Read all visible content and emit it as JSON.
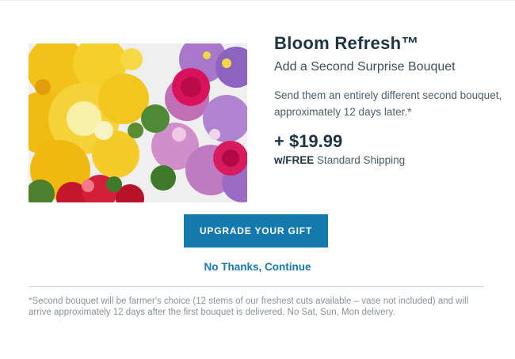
{
  "product": {
    "image_alt": "flower bouquet",
    "title": "Bloom Refresh™",
    "subtitle": "Add a Second Surprise Bouquet",
    "description": "Send them an entirely different second bouquet, approximately 12 days later.*",
    "price": "+ $19.99",
    "shipping_free": "w/FREE",
    "shipping_rest": " Standard Shipping"
  },
  "actions": {
    "upgrade_label": "UPGRADE YOUR GIFT",
    "decline_label": "No Thanks, Continue"
  },
  "footnote": "*Second bouquet will be farmer's choice (12 stems of our freshest cuts available – vase not included) and will arrive approximately 12 days after the first bouquet is delivered. No Sat, Sun, Mon delivery.",
  "colors": {
    "accent": "#1479ad",
    "heading": "#1d3443",
    "body_text": "#4d5e69",
    "footnote_text": "#8a9298"
  }
}
